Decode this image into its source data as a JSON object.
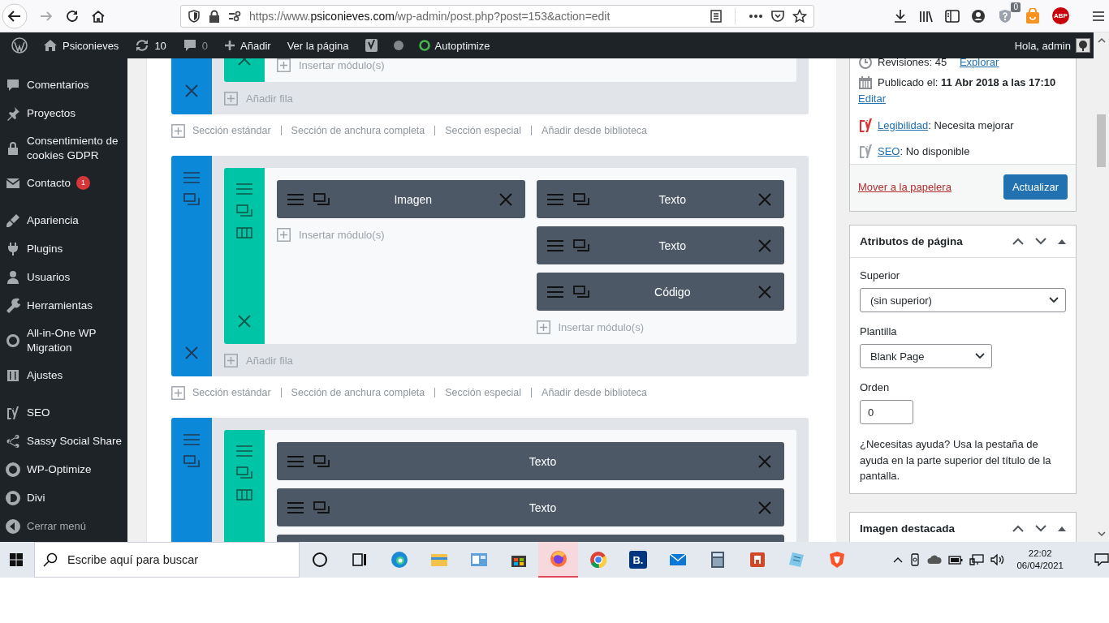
{
  "browser": {
    "url": {
      "prefix": "https://www.",
      "domain": "psiconieves.com",
      "path": "/wp-admin/post.php?post=153&action=edit"
    },
    "extension_badge": "0",
    "adblock_label": "ABP"
  },
  "admin_bar": {
    "site": "Psiconieves",
    "updates": "10",
    "comments": "0",
    "new": "Añadir",
    "view": "Ver la página",
    "autoptimize": "Autoptimize",
    "greeting": "Hola, admin"
  },
  "sidebar": {
    "groups": [
      [
        {
          "label": "Comentarios"
        },
        {
          "label": "Proyectos"
        },
        {
          "label": "Consentimiento de cookies GDPR"
        },
        {
          "label": "Contacto",
          "badge": "1"
        }
      ],
      [
        {
          "label": "Apariencia"
        },
        {
          "label": "Plugins"
        },
        {
          "label": "Usuarios"
        },
        {
          "label": "Herramientas"
        },
        {
          "label": "All-in-One WP Migration"
        },
        {
          "label": "Ajustes"
        }
      ],
      [
        {
          "label": "SEO"
        },
        {
          "label": "Sassy Social Share"
        },
        {
          "label": "WP-Optimize"
        },
        {
          "label": "Divi"
        }
      ]
    ],
    "collapse": "Cerrar menú"
  },
  "builder": {
    "sections": [
      {
        "columns": [
          {
            "insert": "Insertar módulo(s)"
          }
        ],
        "add_row": "Añadir fila",
        "links": [
          "Sección estándar",
          "Sección de anchura completa",
          "Sección especial",
          "Añadir desde biblioteca"
        ]
      },
      {
        "columns": [
          {
            "modules": [
              "Imagen"
            ],
            "insert": "Insertar módulo(s)"
          },
          {
            "modules": [
              "Texto",
              "Texto",
              "Código"
            ],
            "insert": "Insertar módulo(s)"
          }
        ],
        "add_row": "Añadir fila",
        "links": [
          "Sección estándar",
          "Sección de anchura completa",
          "Sección especial",
          "Añadir desde biblioteca"
        ]
      },
      {
        "columns": [
          {
            "modules": [
              "Texto",
              "Texto"
            ],
            "more_below": true
          }
        ]
      }
    ]
  },
  "publish": {
    "revisions": "Revisiones: 45",
    "revisions_link": "Explorar",
    "published": "Publicado el: **11 Abr 2018 a las 17:10**",
    "edit": "Editar",
    "scores": [
      {
        "link": "Legibilidad",
        "value": ": Necesita mejorar",
        "color": "#dc3232"
      },
      {
        "link": "SEO",
        "value": ": No disponible",
        "color": "#a0a5aa"
      }
    ],
    "trash": "Mover a la papelera",
    "update": "Actualizar"
  },
  "page_attributes": {
    "title": "Atributos de página",
    "parent_label": "Superior",
    "parent": "(sin superior)",
    "template_label": "Plantilla",
    "template": "Blank Page",
    "order_label": "Orden",
    "order": "0",
    "help": "¿Necesitas ayuda? Usa la pestaña de ayuda en la parte superior del título de la pantalla."
  },
  "featured_image": {
    "title": "Imagen destacada"
  },
  "taskbar": {
    "search_placeholder": "Escribe aquí para buscar",
    "apps": [
      {
        "selected": false
      },
      {
        "selected": false
      },
      {
        "selected": false
      },
      {
        "selected": false
      },
      {
        "selected": false
      },
      {
        "selected": false
      },
      {
        "selected": true
      },
      {
        "selected": false
      },
      {
        "selected": false,
        "label": "B."
      },
      {
        "selected": false
      },
      {
        "selected": false
      },
      {
        "selected": false
      },
      {
        "selected": false
      },
      {
        "selected": false
      }
    ],
    "time": "22:02",
    "date": "06/04/2021"
  }
}
